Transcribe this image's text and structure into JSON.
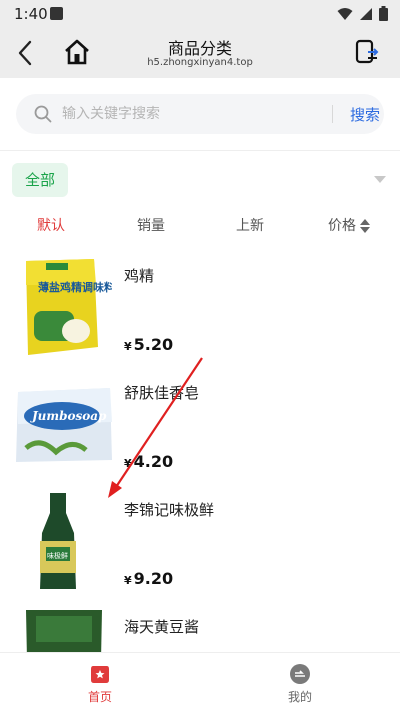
{
  "status_bar": {
    "time": "1:40"
  },
  "nav": {
    "title": "商品分类",
    "url": "h5.zhongxinyan4.top"
  },
  "search": {
    "placeholder": "输入关键字搜索",
    "button_label": "搜索"
  },
  "category": {
    "selected": "全部"
  },
  "sort": {
    "items": [
      {
        "label": "默认",
        "active": true
      },
      {
        "label": "销量",
        "active": false
      },
      {
        "label": "上新",
        "active": false
      },
      {
        "label": "价格",
        "active": false
      }
    ]
  },
  "products": [
    {
      "name": "鸡精",
      "currency": "¥",
      "price": "5.20",
      "image_label": "薄盐鸡精调味料"
    },
    {
      "name": "舒肤佳香皂",
      "currency": "¥",
      "price": "4.20",
      "image_label": "Jumbosoap"
    },
    {
      "name": "李锦记味极鲜",
      "currency": "¥",
      "price": "9.20",
      "image_label": "味极鲜"
    },
    {
      "name": "海天黄豆酱",
      "currency": "¥",
      "price": "",
      "image_label": ""
    }
  ],
  "tab_bar": {
    "items": [
      {
        "label": "首页",
        "icon": "home-icon",
        "active": true
      },
      {
        "label": "我的",
        "icon": "profile-icon",
        "active": false
      }
    ]
  },
  "colors": {
    "accent_red": "#e03b3b",
    "accent_green": "#1aa34a",
    "link_blue": "#2d6be0"
  }
}
